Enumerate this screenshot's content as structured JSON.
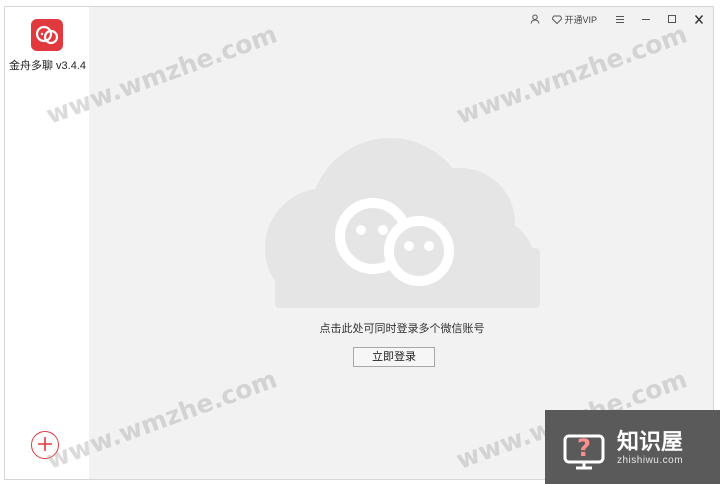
{
  "app": {
    "title": "金舟多聊 v3.4.4"
  },
  "titlebar": {
    "vip_label": "开通VIP"
  },
  "main": {
    "hint": "点击此处可同时登录多个微信账号",
    "login_button": "立即登录"
  },
  "watermark": {
    "text": "www.wmzhe.com"
  },
  "badge": {
    "title": "知识屋",
    "subtitle": "zhishiwu.com"
  },
  "colors": {
    "accent": "#e0393e",
    "content_bg": "#f2f2f2",
    "cloud": "#e5e5e5"
  },
  "icons": [
    "app-logo-icon",
    "user-icon",
    "diamond-icon",
    "menu-icon",
    "minimize-icon",
    "maximize-icon",
    "close-icon",
    "plus-icon",
    "cloud-icon",
    "chat-icon",
    "question-icon"
  ]
}
